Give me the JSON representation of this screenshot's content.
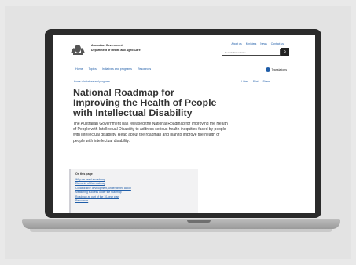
{
  "site": {
    "gov_name": "Australian Government",
    "dept_name": "Department of Health and Aged Care",
    "util_links": [
      "About us",
      "Ministers",
      "News",
      "Contact us"
    ],
    "search_placeholder": "Search this website",
    "search_icon": "magnifier-icon",
    "nav": [
      "Home",
      "Topics",
      "Initiatives and programs",
      "Resources"
    ],
    "translations": "Translations"
  },
  "page": {
    "breadcrumb": "Home  >  Initiatives and programs",
    "share": [
      "Listen",
      "Print",
      "Share"
    ],
    "title": "National Roadmap for Improving the Health of People with Intellectual Disability",
    "intro": "The Australian Government has released the National Roadmap for Improving the Health of People with Intellectual Disability to address serious health inequities faced by people with intellectual disability. Read about the roadmap and plan to improve the health of people with intellectual disability.",
    "on_this_page_title": "On this page",
    "on_this_page": [
      "Why we need a roadmap",
      "Elements of the roadmap",
      "Collaborative development, underpinned action",
      "Measuring success under the roadmap",
      "Roadmap as part of the 10-year plan",
      "Resources"
    ]
  },
  "colors": {
    "link": "#1f5da8",
    "text": "#333333",
    "device": "#2b2b2b"
  }
}
